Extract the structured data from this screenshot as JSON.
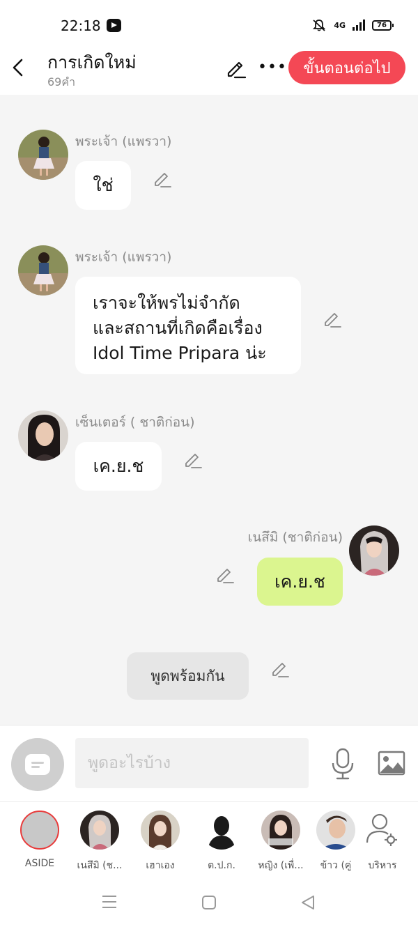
{
  "status_bar": {
    "time": "22:18",
    "network": "4G",
    "battery": "76"
  },
  "header": {
    "title": "การเกิดใหม่",
    "word_count": "69คำ",
    "next_label": "ขั้นตอนต่อไป"
  },
  "messages": [
    {
      "sender": "พระเจ้า (แพรวา)",
      "text": "ใช่"
    },
    {
      "sender": "พระเจ้า (แพรวา)",
      "line1": "เราจะให้พรไม่จำกัด",
      "line2": "และสถานที่เกิดคือเรื่อง",
      "line3": "Idol Time Pripara น่ะ"
    },
    {
      "sender": "เซ็นเตอร์ ( ชาติก่อน)",
      "text": "เค.ย.ช"
    },
    {
      "sender": "เนสึมิ (ชาติก่อน)",
      "text": "เค.ย.ช"
    }
  ],
  "chorus_label": "พูดพร้อมกัน",
  "composer": {
    "placeholder": "พูดอะไรบ้าง"
  },
  "participants": [
    {
      "label": "ASIDE"
    },
    {
      "label": "เนสึมิ (ช..."
    },
    {
      "label": "เฮาเอง"
    },
    {
      "label": "ต.ป.ก."
    },
    {
      "label": "หญิง (เพื่..."
    },
    {
      "label": "ข้าว (คู่"
    },
    {
      "label": "บริหาร"
    }
  ],
  "colors": {
    "accent": "#f44855",
    "my_bubble": "#dbf58f",
    "chat_bg": "#f5f5f5"
  }
}
